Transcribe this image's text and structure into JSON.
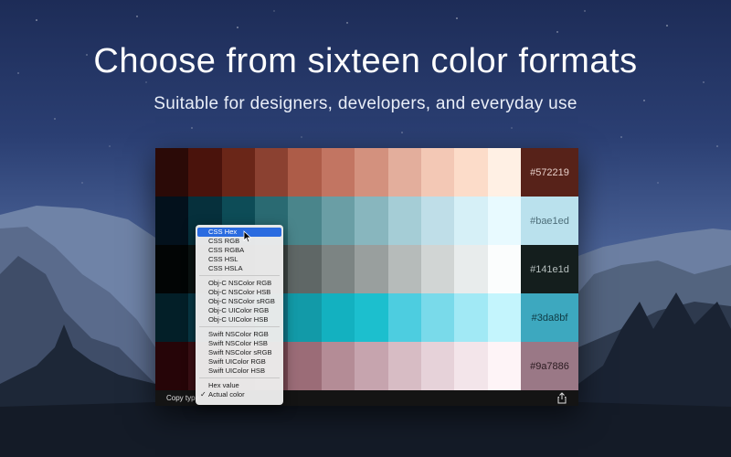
{
  "headline": "Choose from sixteen color formats",
  "subheadline": "Suitable for designers, developers, and everyday use",
  "palette": {
    "rows": [
      {
        "hex": "#572219",
        "swatches": [
          "#2b0a07",
          "#4a130c",
          "#6a2618",
          "#8b4131",
          "#ad5c48",
          "#c27562",
          "#d3917e",
          "#e3ae9c",
          "#f3c8b5",
          "#fcdcc9",
          "#fff0e4"
        ],
        "hex_bg": "#572219",
        "hex_color": "#e7cfc9"
      },
      {
        "hex": "#bae1ed",
        "swatches": [
          "#03111c",
          "#06303c",
          "#0d4c57",
          "#2a6a72",
          "#4a858b",
          "#6a9ea5",
          "#88b6be",
          "#a5cdd6",
          "#bfdee8",
          "#d6f0f7",
          "#e8faff"
        ],
        "hex_bg": "#bae1ed",
        "hex_color": "#4e6f7a"
      },
      {
        "hex": "#141e1d",
        "swatches": [
          "#020505",
          "#0a1211",
          "#1d2625",
          "#3d4543",
          "#5f6766",
          "#7c8483",
          "#999f9e",
          "#b6bbba",
          "#d1d5d4",
          "#e8ecec",
          "#fbfdfd"
        ],
        "hex_bg": "#141e1d",
        "hex_color": "#b6bfbe"
      },
      {
        "hex": "#3da8bf",
        "swatches": [
          "#031f28",
          "#073745",
          "#0b5466",
          "#10788a",
          "#129aa8",
          "#13b1c0",
          "#1cbfce",
          "#4dcde0",
          "#79daea",
          "#a1e9f5",
          "#c4f5fd"
        ],
        "hex_bg": "#3da8bf",
        "hex_color": "#0f3a44"
      },
      {
        "hex": "#9a7886",
        "swatches": [
          "#260508",
          "#3b0f14",
          "#5b2a32",
          "#7c4b55",
          "#9b6c77",
          "#b48c96",
          "#c6a4ae",
          "#d7bcc4",
          "#e6d2d9",
          "#f3e5ea",
          "#fef4f7"
        ],
        "hex_bg": "#9a7886",
        "hex_color": "#2a1a20"
      }
    ]
  },
  "bottom_bar": {
    "copy_label": "Copy type"
  },
  "menu": {
    "groups": [
      [
        "CSS Hex",
        "CSS RGB",
        "CSS RGBA",
        "CSS HSL",
        "CSS HSLA"
      ],
      [
        "Obj-C NSColor RGB",
        "Obj-C NSColor HSB",
        "Obj-C NSColor sRGB",
        "Obj-C UIColor RGB",
        "Obj-C UIColor HSB"
      ],
      [
        "Swift NSColor RGB",
        "Swift NSColor HSB",
        "Swift NSColor sRGB",
        "Swift UIColor RGB",
        "Swift UIColor HSB"
      ],
      [
        "Hex value",
        "Actual color"
      ]
    ],
    "selected": "CSS Hex",
    "checked": "Actual color"
  },
  "colors": {
    "accent": "#2a6be0",
    "menu_bg": "#ececec"
  },
  "icons": {
    "share": "share-icon",
    "cursor": "cursor-icon",
    "check": "checkmark-icon"
  }
}
